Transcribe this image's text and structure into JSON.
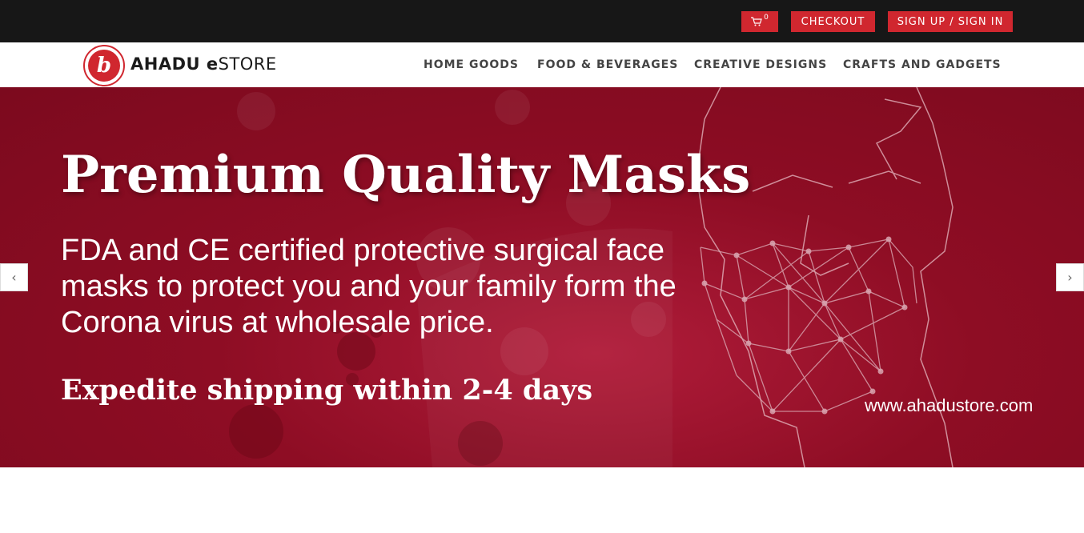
{
  "topbar": {
    "cart": {
      "icon": "cart-icon",
      "count": "0"
    },
    "checkout_label": "CHECKOUT",
    "signin_label": "SIGN UP / SIGN IN"
  },
  "header": {
    "logo_letter": "b",
    "brand_bold": "AHADU e",
    "brand_rest": "STORE",
    "nav": [
      {
        "label": "HOME GOODS"
      },
      {
        "label": "FOOD & BEVERAGES"
      },
      {
        "label": "CREATIVE DESIGNS"
      },
      {
        "label": "CRAFTS AND GADGETS"
      }
    ]
  },
  "hero": {
    "title": "Premium Quality Masks",
    "body": "FDA and CE certified protective surgical face masks to protect you and your family form the Corona virus at wholesale price.",
    "shipping": "Expedite shipping within 2-4 days",
    "url": "www.ahadustore.com"
  },
  "slider": {
    "prev_icon": "‹",
    "next_icon": "›"
  },
  "colors": {
    "accent": "#d0272f",
    "topbar": "#171717",
    "hero_bg": "#8e0d24"
  }
}
